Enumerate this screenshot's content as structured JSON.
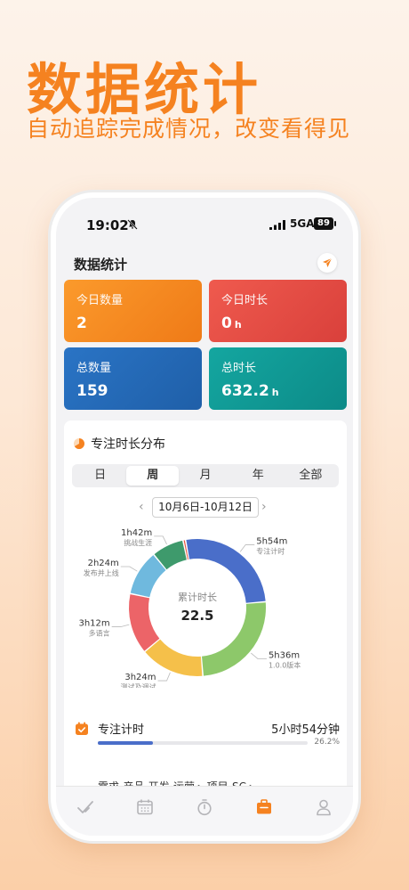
{
  "hero": {
    "title": "数据统计",
    "subtitle": "自动追踪完成情况，改变看得见"
  },
  "status_bar": {
    "time": "19:02",
    "network": "5GA",
    "battery": "89",
    "icons": [
      "bell-slash-icon",
      "signal-icon"
    ]
  },
  "page": {
    "title": "数据统计",
    "share_icon": "paper-plane-icon"
  },
  "stats": {
    "today_count": {
      "label": "今日数量",
      "value": "2",
      "unit": ""
    },
    "today_duration": {
      "label": "今日时长",
      "value": "0",
      "unit": "h"
    },
    "total_count": {
      "label": "总数量",
      "value": "159",
      "unit": ""
    },
    "total_duration": {
      "label": "总时长",
      "value": "632.2",
      "unit": "h"
    }
  },
  "distribution": {
    "title": "专注时长分布",
    "icon": "pie-chart-icon",
    "tabs": [
      "日",
      "周",
      "月",
      "年",
      "全部"
    ],
    "active_tab": "周",
    "date_range": "10月6日-10月12日",
    "center_label": "累计时长",
    "center_value": "22.5"
  },
  "chart_data": {
    "type": "pie",
    "donut": true,
    "center_label": "累计时长",
    "center_value": 22.5,
    "slices": [
      {
        "label": "专注计时",
        "value_text": "5h54m",
        "minutes": 354,
        "color": "#4a6ec9"
      },
      {
        "label": "1.0.0版本",
        "value_text": "5h36m",
        "minutes": 336,
        "color": "#8dc86a"
      },
      {
        "label": "测试及调试",
        "value_text": "3h24m",
        "minutes": 204,
        "color": "#f5c04a"
      },
      {
        "label": "多语言",
        "value_text": "3h12m",
        "minutes": 192,
        "color": "#ec6468"
      },
      {
        "label": "发布并上线",
        "value_text": "2h24m",
        "minutes": 144,
        "color": "#6fb9de"
      },
      {
        "label": "挑战生涯",
        "value_text": "1h42m",
        "minutes": 102,
        "color": "#3e9a6c"
      },
      {
        "label": "",
        "value_text": "",
        "minutes": 8,
        "color": "#e8543f"
      }
    ]
  },
  "task": {
    "name": "专注计时",
    "time": "5小时54分钟",
    "percent_text": "26.2%",
    "percent": 26.2,
    "icon": "calendar-check-icon",
    "path": "需求-产品-开发-运营 ▸ 项目-SC ▸"
  },
  "tab_bar": {
    "tabs": [
      "check-icon",
      "calendar-icon",
      "timer-icon",
      "briefcase-icon",
      "person-icon"
    ],
    "active": "briefcase-icon",
    "active_color": "#f58220",
    "inactive_color": "#b4b4b8"
  }
}
